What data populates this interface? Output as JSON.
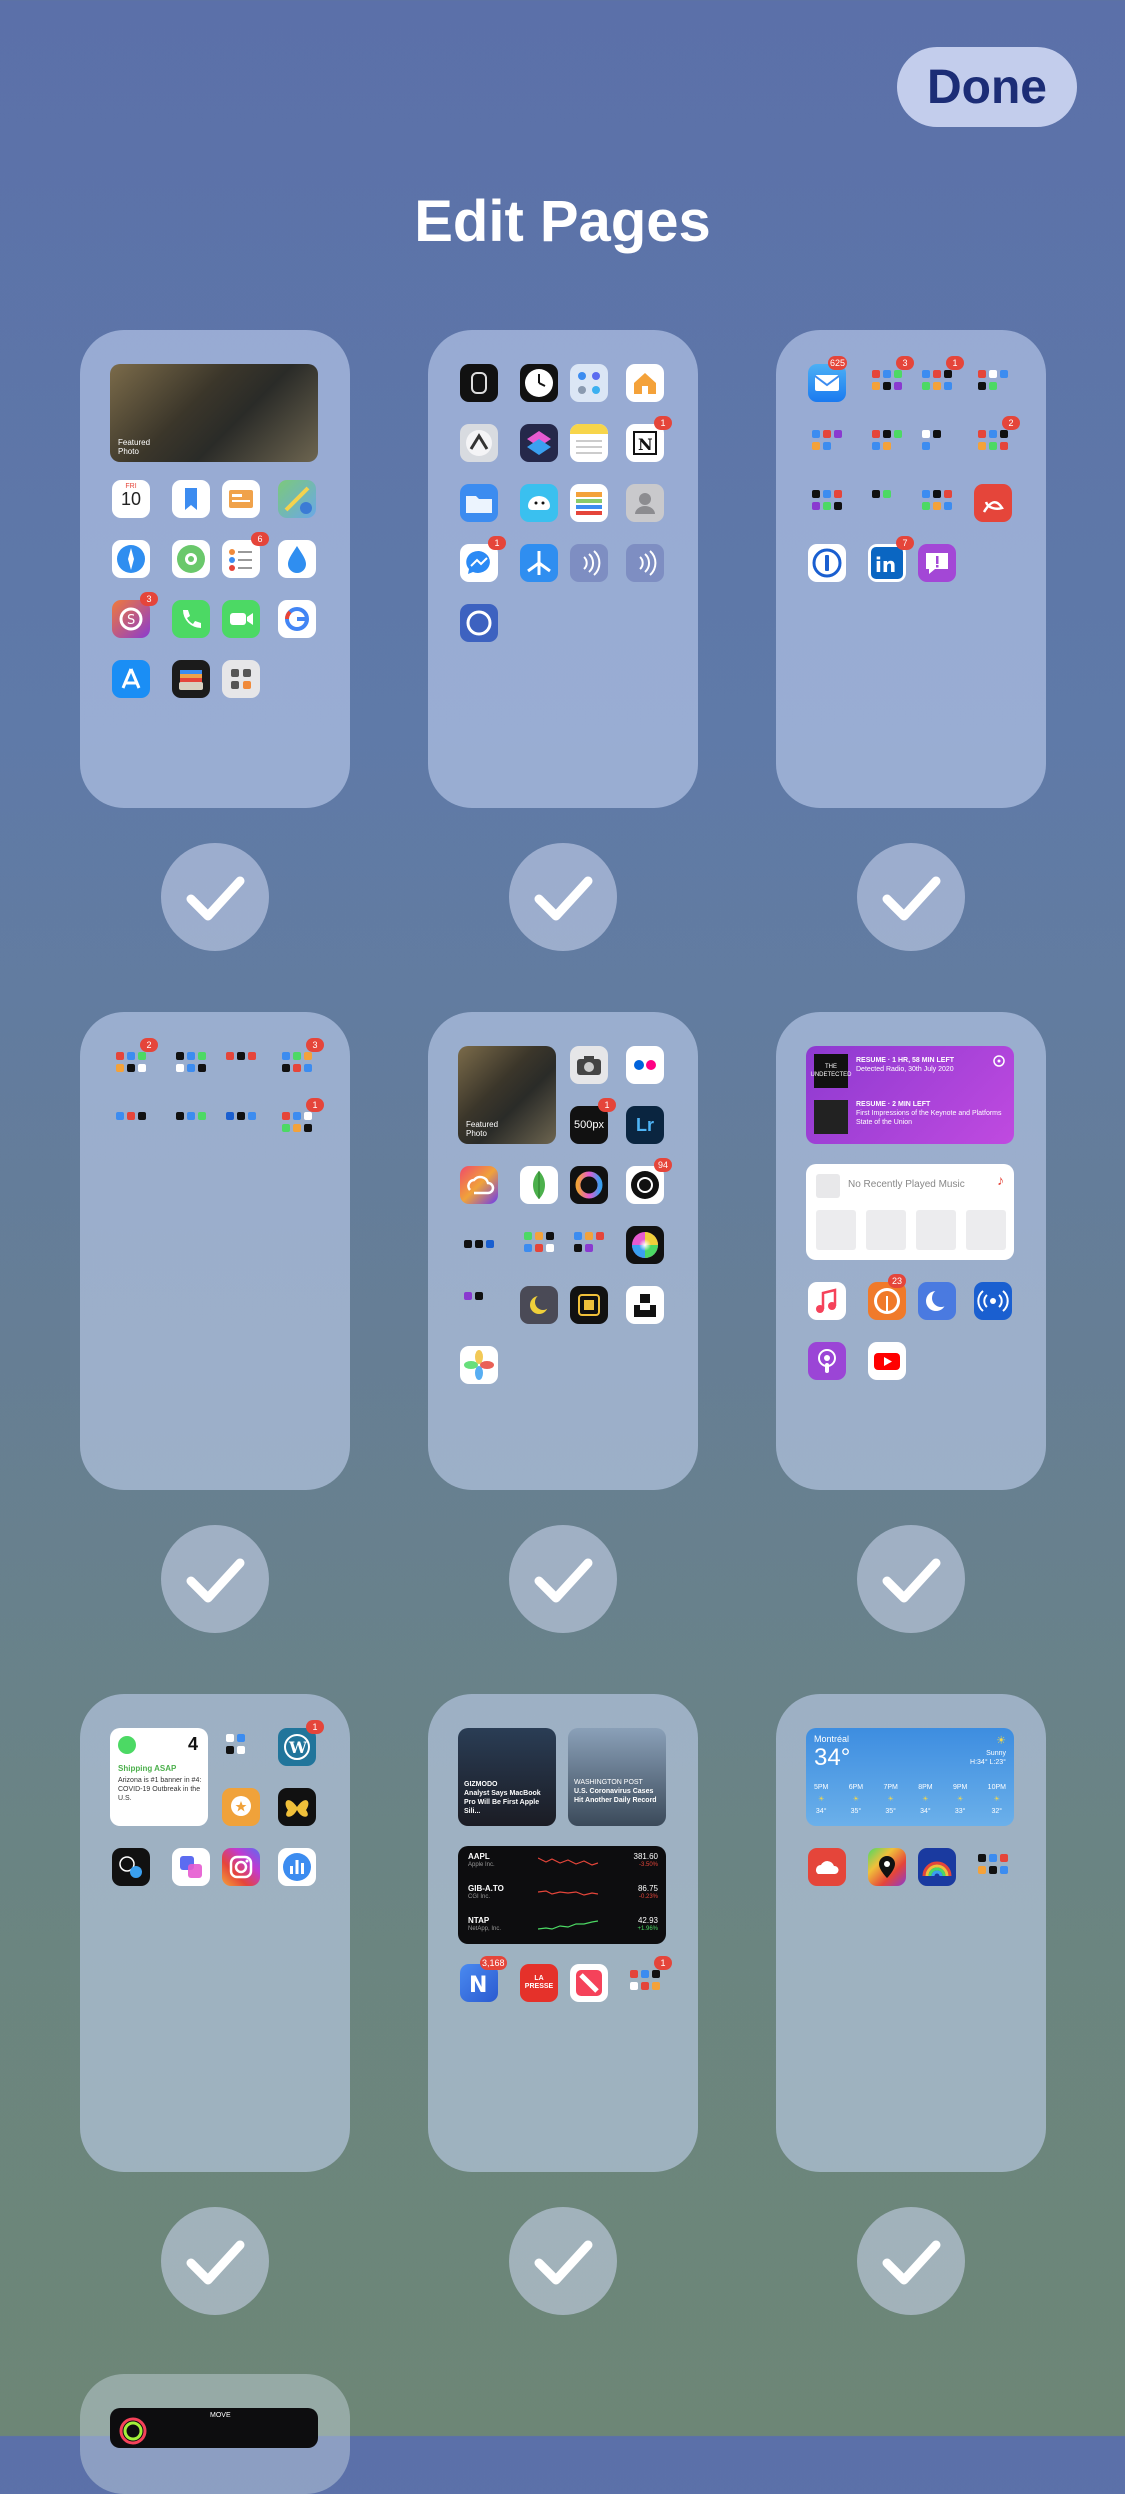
{
  "header": {
    "done_label": "Done",
    "title": "Edit Pages"
  },
  "pages": [
    {
      "label": "page-1",
      "photo_widget": {
        "label": "Featured",
        "sub": "Photo"
      },
      "calendar": {
        "day": "FRI",
        "date": "10"
      },
      "badges": [
        "6",
        "3"
      ]
    },
    {
      "label": "page-2",
      "badges": [
        "1",
        "1"
      ]
    },
    {
      "label": "page-3",
      "badges": [
        "625",
        "3",
        "1",
        "2",
        "7"
      ]
    },
    {
      "label": "page-4",
      "badges": [
        "2",
        "3",
        "1"
      ]
    },
    {
      "label": "page-5",
      "photo_widget": {
        "label": "Featured",
        "sub": "Photo"
      },
      "lightroom": "Lr",
      "five_hundred": "500px",
      "badges": [
        "1",
        "94"
      ]
    },
    {
      "label": "page-6",
      "podcast_rows": [
        {
          "title": "RESUME · 1 HR, 58 MIN LEFT",
          "desc": "Detected Radio, 30th July 2020"
        },
        {
          "title": "RESUME · 2 MIN LEFT",
          "desc": "First Impressions of the Keynote and Platforms State of the Union"
        }
      ],
      "podcast_art": "THE UNDETECTED",
      "music_widget": "No Recently Played Music",
      "badges": [
        "23"
      ]
    },
    {
      "label": "page-7",
      "reminders": {
        "count": "4",
        "title": "Shipping ASAP",
        "body": "Arizona is #1 banner in #4: COVID-19 Outbreak in the U.S."
      },
      "badges": [
        "1"
      ]
    },
    {
      "label": "page-8",
      "news": [
        {
          "source": "GIZMODO",
          "headline": "Analyst Says MacBook Pro Will Be First Apple Sili..."
        },
        {
          "source": "WASHINGTON POST",
          "headline": "U.S. Coronavirus Cases Hit Another Daily Record"
        }
      ],
      "stocks": [
        {
          "symbol": "AAPL",
          "name": "Apple Inc.",
          "price": "381.60",
          "change": "-3.50%"
        },
        {
          "symbol": "GIB-A.TO",
          "name": "CGI Inc.",
          "price": "86.75",
          "change": "-0.23%"
        },
        {
          "symbol": "NTAP",
          "name": "NetApp, Inc.",
          "price": "42.93",
          "change": "+1.96%"
        }
      ],
      "la_presse": "LA PRESSE",
      "badges": [
        "3,168",
        "1"
      ]
    },
    {
      "label": "page-9",
      "weather": {
        "city": "Montréal",
        "temp": "34°",
        "condition": "Sunny",
        "range": "H:34° L:23°",
        "hours": [
          {
            "time": "5PM",
            "temp": "34°"
          },
          {
            "time": "6PM",
            "temp": "35°"
          },
          {
            "time": "7PM",
            "temp": "35°"
          },
          {
            "time": "8PM",
            "temp": "34°"
          },
          {
            "time": "9PM",
            "temp": "33°"
          },
          {
            "time": "10PM",
            "temp": "32°"
          }
        ]
      }
    },
    {
      "label": "page-10",
      "widget_text": "MOVE"
    }
  ],
  "colors": {
    "badge": "#e5453a",
    "done_bg": "#c3cdec",
    "done_text": "#1c2d76"
  }
}
